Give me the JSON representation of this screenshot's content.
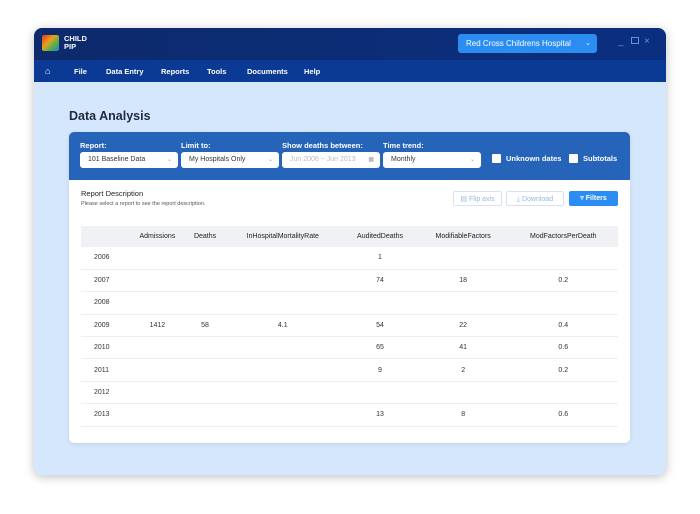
{
  "app": {
    "brand_line1": "CHILD",
    "brand_line2": "PIP",
    "hospital": "Red Cross Childrens Hospital"
  },
  "nav": [
    "File",
    "Data Entry",
    "Reports",
    "Tools",
    "Documents",
    "Help"
  ],
  "page": {
    "title": "Data Analysis"
  },
  "filters": {
    "report_label": "Report:",
    "report_value": "101 Baseline Data",
    "limit_label": "Limit to:",
    "limit_value": "My Hospitals Only",
    "deaths_label": "Show deaths between:",
    "deaths_value": "Jun 2006 ~ Jun 2013",
    "trend_label": "Time trend:",
    "trend_value": "Monthly",
    "unknown_dates": "Unknown dates",
    "subtotals": "Subtotals"
  },
  "description": {
    "title": "Report Description",
    "text": "Please select a report to see the report description."
  },
  "buttons": {
    "flip": "Flip axis",
    "download": "Download",
    "filters": "Filters"
  },
  "table": {
    "headers": [
      "",
      "Admissions",
      "Deaths",
      "InHospitalMortalityRate",
      "AuditedDeaths",
      "ModifiableFactors",
      "ModFactorsPerDeath"
    ],
    "rows": [
      [
        "2006",
        "",
        "",
        "",
        "1",
        "",
        ""
      ],
      [
        "2007",
        "",
        "",
        "",
        "74",
        "18",
        "0.2"
      ],
      [
        "2008",
        "",
        "",
        "",
        "",
        "",
        ""
      ],
      [
        "2009",
        "1412",
        "58",
        "4.1",
        "54",
        "22",
        "0.4"
      ],
      [
        "2010",
        "",
        "",
        "",
        "65",
        "41",
        "0.6"
      ],
      [
        "2011",
        "",
        "",
        "",
        "9",
        "2",
        "0.2"
      ],
      [
        "2012",
        "",
        "",
        "",
        "",
        "",
        ""
      ],
      [
        "2013",
        "",
        "",
        "",
        "13",
        "8",
        "0.6"
      ]
    ]
  }
}
